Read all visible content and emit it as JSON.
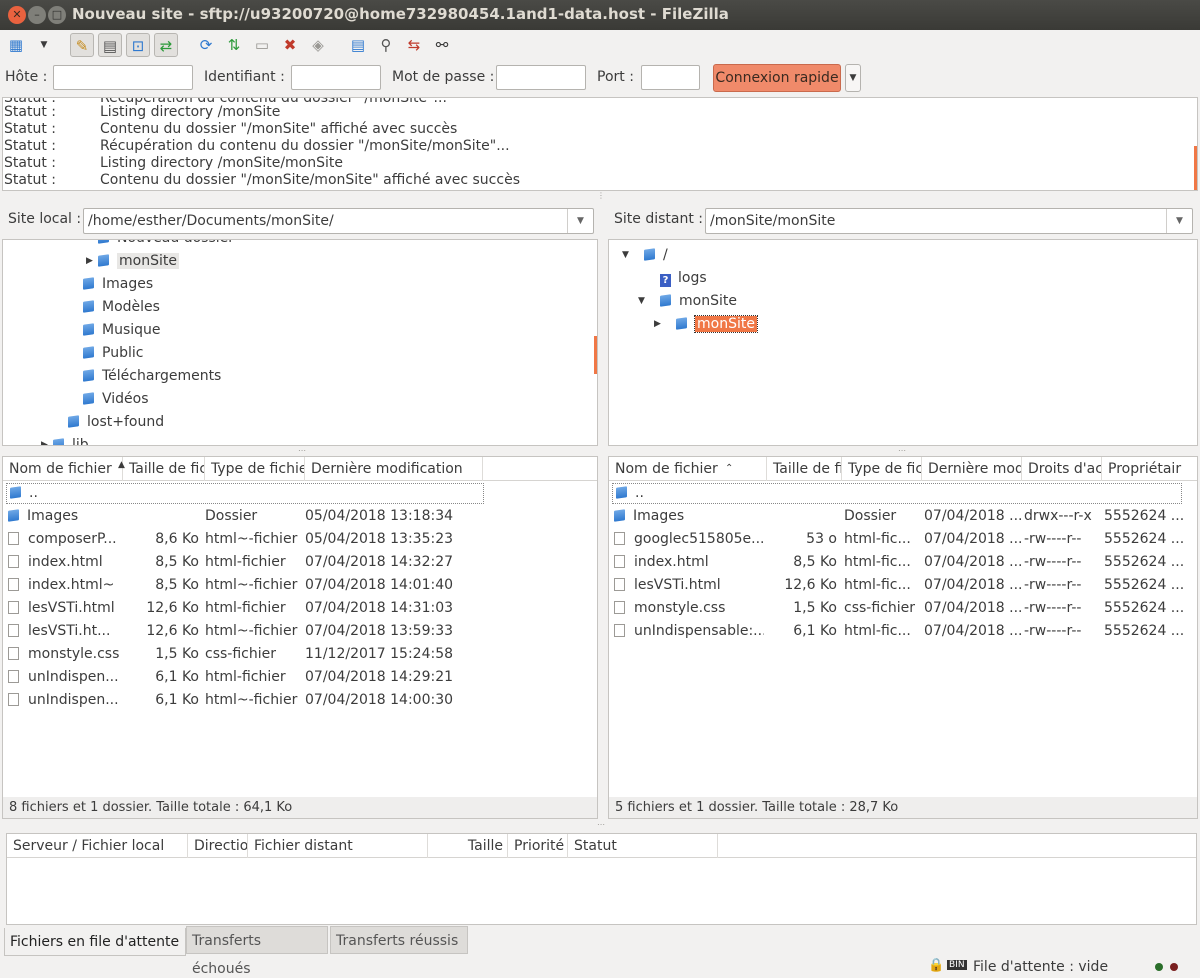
{
  "window": {
    "title": "Nouveau site - sftp://u93200720@home732980454.1and1-data.host - FileZilla"
  },
  "quickconnect": {
    "host_label": "Hôte :",
    "user_label": "Identifiant :",
    "pass_label": "Mot de passe :",
    "port_label": "Port :",
    "host_value": "",
    "user_value": "",
    "pass_value": "",
    "port_value": "",
    "connect_label": "Connexion rapide"
  },
  "log": [
    {
      "k": "Statut :",
      "v": "Récupération du contenu du dossier \"/monSite\"..."
    },
    {
      "k": "Statut :",
      "v": "Listing directory /monSite"
    },
    {
      "k": "Statut :",
      "v": "Contenu du dossier \"/monSite\" affiché avec succès"
    },
    {
      "k": "Statut :",
      "v": "Récupération du contenu du dossier \"/monSite/monSite\"..."
    },
    {
      "k": "Statut :",
      "v": "Listing directory /monSite/monSite"
    },
    {
      "k": "Statut :",
      "v": "Contenu du dossier \"/monSite/monSite\" affiché avec succès"
    }
  ],
  "local": {
    "label": "Site local :",
    "path": "/home/esther/Documents/monSite/",
    "tree": [
      {
        "name": "Nouveau dossier",
        "icon": "folder",
        "indent": 2,
        "arrow": ""
      },
      {
        "name": "monSite",
        "icon": "folder-open",
        "indent": 2,
        "arrow": "▶",
        "selected": true
      },
      {
        "name": "Images",
        "icon": "folder",
        "indent": 1,
        "arrow": ""
      },
      {
        "name": "Modèles",
        "icon": "folder",
        "indent": 1,
        "arrow": ""
      },
      {
        "name": "Musique",
        "icon": "folder",
        "indent": 1,
        "arrow": ""
      },
      {
        "name": "Public",
        "icon": "folder",
        "indent": 1,
        "arrow": ""
      },
      {
        "name": "Téléchargements",
        "icon": "folder",
        "indent": 1,
        "arrow": ""
      },
      {
        "name": "Vidéos",
        "icon": "folder",
        "indent": 1,
        "arrow": ""
      },
      {
        "name": "lost+found",
        "icon": "folder",
        "indent": 0,
        "arrow": ""
      },
      {
        "name": "lib",
        "icon": "folder",
        "indent": -1,
        "arrow": "▶"
      }
    ],
    "columns": [
      "Nom de fichier",
      "Taille de fichier",
      "Type de fichier",
      "Dernière modification"
    ],
    "files": [
      {
        "name": "..",
        "size": "",
        "type": "",
        "date": "",
        "icon": "folder"
      },
      {
        "name": "Images",
        "size": "",
        "type": "Dossier",
        "date": "05/04/2018 13:18:34",
        "icon": "folder"
      },
      {
        "name": "composerP...",
        "size": "8,6 Ko",
        "type": "html~-fichier",
        "date": "05/04/2018 13:35:23",
        "icon": "doc"
      },
      {
        "name": "index.html",
        "size": "8,5 Ko",
        "type": "html-fichier",
        "date": "07/04/2018 14:32:27",
        "icon": "doc"
      },
      {
        "name": "index.html~",
        "size": "8,5 Ko",
        "type": "html~-fichier",
        "date": "07/04/2018 14:01:40",
        "icon": "doc"
      },
      {
        "name": "lesVSTi.html",
        "size": "12,6 Ko",
        "type": "html-fichier",
        "date": "07/04/2018 14:31:03",
        "icon": "doc"
      },
      {
        "name": "lesVSTi.ht...",
        "size": "12,6 Ko",
        "type": "html~-fichier",
        "date": "07/04/2018 13:59:33",
        "icon": "doc"
      },
      {
        "name": "monstyle.css",
        "size": "1,5 Ko",
        "type": "css-fichier",
        "date": "11/12/2017 15:24:58",
        "icon": "doc"
      },
      {
        "name": "unIndispen...",
        "size": "6,1 Ko",
        "type": "html-fichier",
        "date": "07/04/2018 14:29:21",
        "icon": "doc"
      },
      {
        "name": "unIndispen...",
        "size": "6,1 Ko",
        "type": "html~-fichier",
        "date": "07/04/2018 14:00:30",
        "icon": "doc"
      }
    ],
    "status": "8 fichiers et 1 dossier. Taille totale : 64,1 Ko"
  },
  "remote": {
    "label": "Site distant :",
    "path": "/monSite/monSite",
    "tree": [
      {
        "name": "/",
        "icon": "folder",
        "arrow": "▼",
        "level": 0
      },
      {
        "name": "logs",
        "icon": "question",
        "arrow": "",
        "level": 1
      },
      {
        "name": "monSite",
        "icon": "folder",
        "arrow": "▼",
        "level": 1
      },
      {
        "name": "monSite",
        "icon": "folder-open",
        "arrow": "▶",
        "level": 2,
        "selected": true
      }
    ],
    "columns": [
      "Nom de fichier",
      "Taille de fi",
      "Type de fic",
      "Dernière mod",
      "Droits d'ac",
      "Propriétair"
    ],
    "files": [
      {
        "name": "..",
        "size": "",
        "type": "",
        "date": "",
        "perms": "",
        "owner": "",
        "icon": "folder"
      },
      {
        "name": "Images",
        "size": "",
        "type": "Dossier",
        "date": "07/04/2018 ...",
        "perms": "drwx---r-x",
        "owner": "5552624 ...",
        "icon": "folder"
      },
      {
        "name": "googlec515805e...",
        "size": "53 o",
        "type": "html-fic...",
        "date": "07/04/2018 ...",
        "perms": "-rw----r--",
        "owner": "5552624 ...",
        "icon": "doc"
      },
      {
        "name": "index.html",
        "size": "8,5 Ko",
        "type": "html-fic...",
        "date": "07/04/2018 ...",
        "perms": "-rw----r--",
        "owner": "5552624 ...",
        "icon": "doc"
      },
      {
        "name": "lesVSTi.html",
        "size": "12,6 Ko",
        "type": "html-fic...",
        "date": "07/04/2018 ...",
        "perms": "-rw----r--",
        "owner": "5552624 ...",
        "icon": "doc"
      },
      {
        "name": "monstyle.css",
        "size": "1,5 Ko",
        "type": "css-fichier",
        "date": "07/04/2018 ...",
        "perms": "-rw----r--",
        "owner": "5552624 ...",
        "icon": "doc"
      },
      {
        "name": "unIndispensable:...",
        "size": "6,1 Ko",
        "type": "html-fic...",
        "date": "07/04/2018 ...",
        "perms": "-rw----r--",
        "owner": "5552624 ...",
        "icon": "doc"
      }
    ],
    "status": "5 fichiers et 1 dossier. Taille totale : 28,7 Ko"
  },
  "queue": {
    "columns": [
      "Serveur / Fichier local",
      "Directio",
      "Fichier distant",
      "Taille",
      "Priorité",
      "Statut"
    ],
    "tabs": [
      "Fichiers en file d'attente",
      "Transferts échoués",
      "Transferts réussis"
    ],
    "status": "File d'attente : vide"
  },
  "colors": {
    "accent": "#f07746",
    "connect_button": "#f08a6a",
    "folder": "#2f79cf"
  }
}
